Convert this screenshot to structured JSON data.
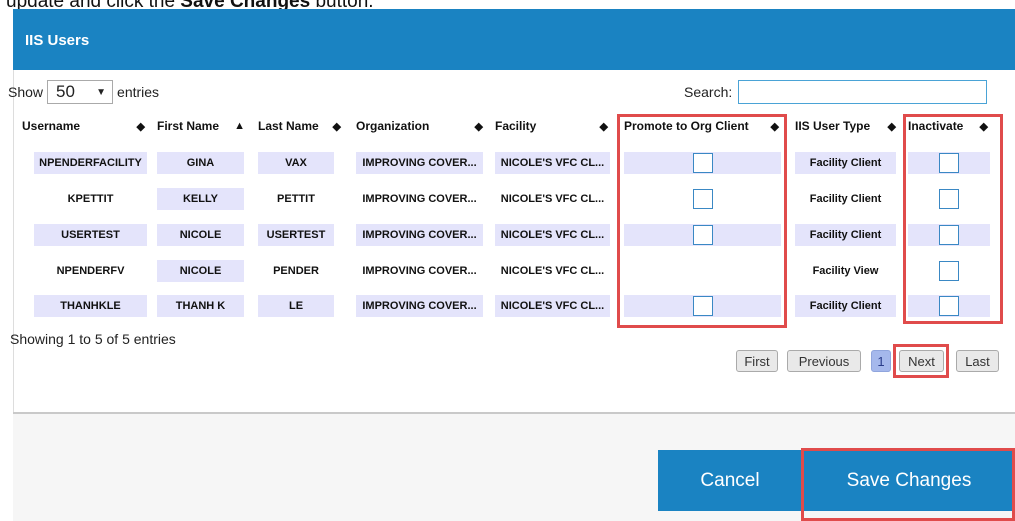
{
  "instruction": {
    "prefix": "update and click the ",
    "bold": "Save Changes",
    "suffix": " button."
  },
  "modal": {
    "title": "IIS Users"
  },
  "table_controls": {
    "show_label": "Show",
    "entries_value": "50",
    "entries_label": "entries",
    "search_label": "Search:",
    "search_value": ""
  },
  "columns": [
    "Username",
    "First Name",
    "Last Name",
    "Organization",
    "Facility",
    "Promote to Org Client",
    "IIS User Type",
    "Inactivate"
  ],
  "rows": [
    {
      "username": "NPENDERFACILITY",
      "first": "GINA",
      "last": "VAX",
      "org": "IMPROVING COVER...",
      "facility": "NICOLE'S VFC CL...",
      "promote": true,
      "type": "Facility Client"
    },
    {
      "username": "KPETTIT",
      "first": "KELLY",
      "last": "PETTIT",
      "org": "IMPROVING COVER...",
      "facility": "NICOLE'S VFC CL...",
      "promote": true,
      "type": "Facility Client"
    },
    {
      "username": "USERTEST",
      "first": "NICOLE",
      "last": "USERTEST",
      "org": "IMPROVING COVER...",
      "facility": "NICOLE'S VFC CL...",
      "promote": true,
      "type": "Facility Client"
    },
    {
      "username": "NPENDERFV",
      "first": "NICOLE",
      "last": "PENDER",
      "org": "IMPROVING COVER...",
      "facility": "NICOLE'S VFC CL...",
      "promote": false,
      "type": "Facility View"
    },
    {
      "username": "THANHKLE",
      "first": "THANH K",
      "last": "LE",
      "org": "IMPROVING COVER...",
      "facility": "NICOLE'S VFC CL...",
      "promote": true,
      "type": "Facility Client"
    }
  ],
  "info_text": "Showing 1 to 5 of 5 entries",
  "pagination": {
    "first": "First",
    "previous": "Previous",
    "current": "1",
    "next": "Next",
    "last": "Last"
  },
  "footer": {
    "cancel": "Cancel",
    "save": "Save Changes"
  },
  "colors": {
    "header": "#1a83c2",
    "shade": "#e4e4fb",
    "highlight": "#e04b4b",
    "active_page": "#a5b8ec"
  }
}
